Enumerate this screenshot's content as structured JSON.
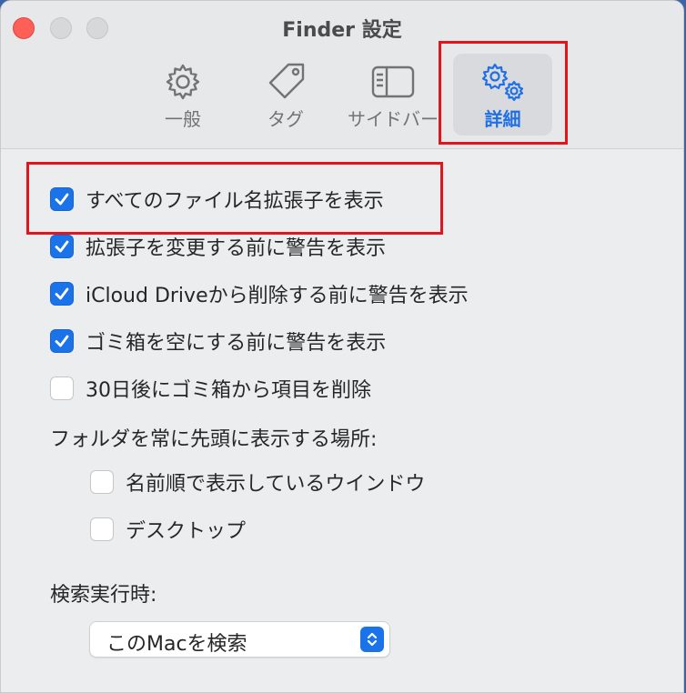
{
  "window": {
    "title": "Finder 設定",
    "colors": {
      "accent": "#1a73e8",
      "highlight": "#e3141b"
    }
  },
  "tabs": [
    {
      "label": "一般",
      "icon": "gear-icon"
    },
    {
      "label": "タグ",
      "icon": "tag-icon"
    },
    {
      "label": "サイドバー",
      "icon": "sidebar-icon"
    },
    {
      "label": "詳細",
      "icon": "gears-icon",
      "selected": true
    }
  ],
  "options": [
    {
      "label": "すべてのファイル名拡張子を表示",
      "checked": true
    },
    {
      "label": "拡張子を変更する前に警告を表示",
      "checked": true
    },
    {
      "label": "iCloud Driveから削除する前に警告を表示",
      "checked": true
    },
    {
      "label": "ゴミ箱を空にする前に警告を表示",
      "checked": true
    },
    {
      "label": "30日後にゴミ箱から項目を削除",
      "checked": false
    }
  ],
  "folders_first": {
    "heading": "フォルダを常に先頭に表示する場所:",
    "items": [
      {
        "label": "名前順で表示しているウインドウ",
        "checked": false
      },
      {
        "label": "デスクトップ",
        "checked": false
      }
    ]
  },
  "search": {
    "heading": "検索実行時:",
    "selected": "このMacを検索"
  }
}
